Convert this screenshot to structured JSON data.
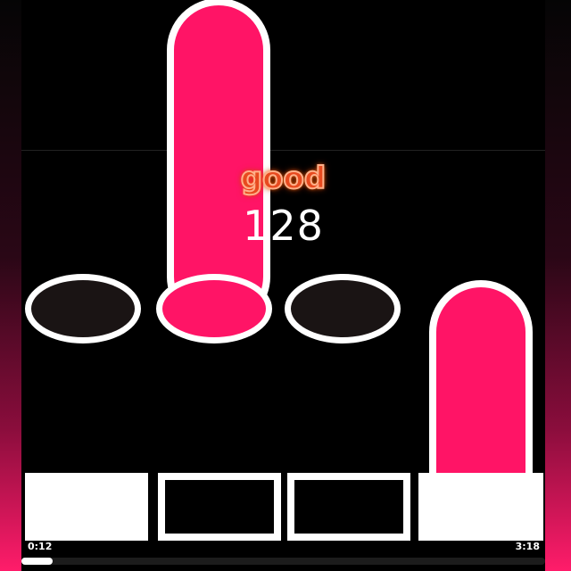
{
  "hud": {
    "judgement": "good",
    "combo": "128",
    "time_current": "0:12",
    "time_total": "3:18",
    "progress_fraction": 0.06
  },
  "colors": {
    "note": "#ff1466",
    "outline": "#ffffff",
    "judgement_text": "#e84a1f",
    "background_gradient_end": "#ff1c6a"
  },
  "lanes": [
    {
      "receptor": "empty",
      "pad": "pressed"
    },
    {
      "receptor": "hit",
      "pad": "idle"
    },
    {
      "receptor": "empty",
      "pad": "idle"
    },
    {
      "receptor": "none",
      "pad": "pressed"
    }
  ]
}
